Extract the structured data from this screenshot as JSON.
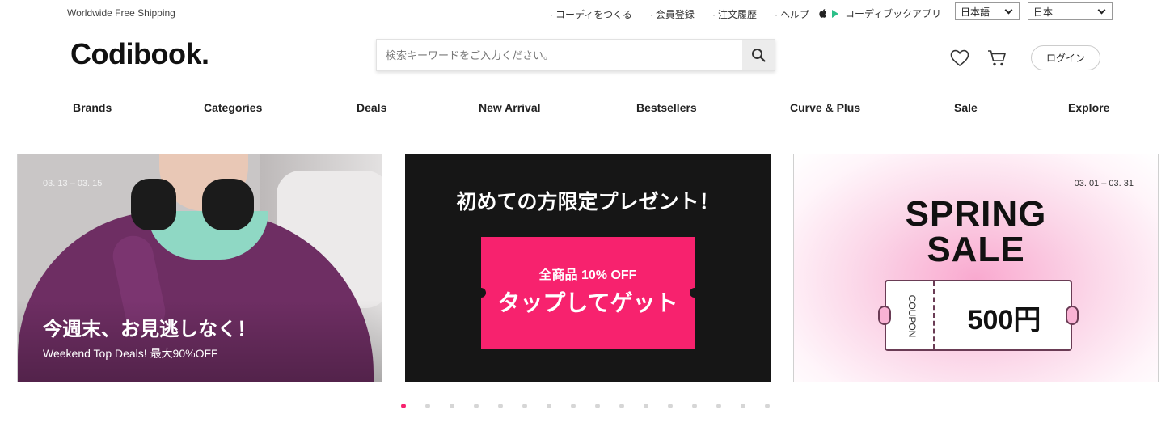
{
  "topbar": {
    "shipping": "Worldwide Free Shipping",
    "links": [
      "コーディをつくる",
      "会員登録",
      "注文履歴",
      "ヘルプ"
    ],
    "app_label": "コーディブックアプリ",
    "language": "日本語",
    "country": "日本"
  },
  "header": {
    "logo": "Codibook.",
    "search_placeholder": "検索キーワードをご入力ください。",
    "login": "ログイン"
  },
  "nav": [
    "Brands",
    "Categories",
    "Deals",
    "New Arrival",
    "Bestsellers",
    "Curve & Plus",
    "Sale",
    "Explore"
  ],
  "banners": {
    "weekend": {
      "date": "03. 13 – 03. 15",
      "title": "今週末、お見逃しなく！",
      "subtitle": "Weekend Top Deals! 最大90%OFF"
    },
    "first": {
      "title": "初めての方限定プレゼント！",
      "offer": "全商品 10% OFF",
      "cta": "タップしてゲット"
    },
    "spring": {
      "date": "03. 01 – 03. 31",
      "title_line1": "SPRING",
      "title_line2": "SALE",
      "coupon_label": "COUPON",
      "amount": "500円"
    }
  },
  "carousel": {
    "total": 16,
    "active": 1
  },
  "colors": {
    "accent": "#f7226e",
    "dark": "#161616"
  }
}
